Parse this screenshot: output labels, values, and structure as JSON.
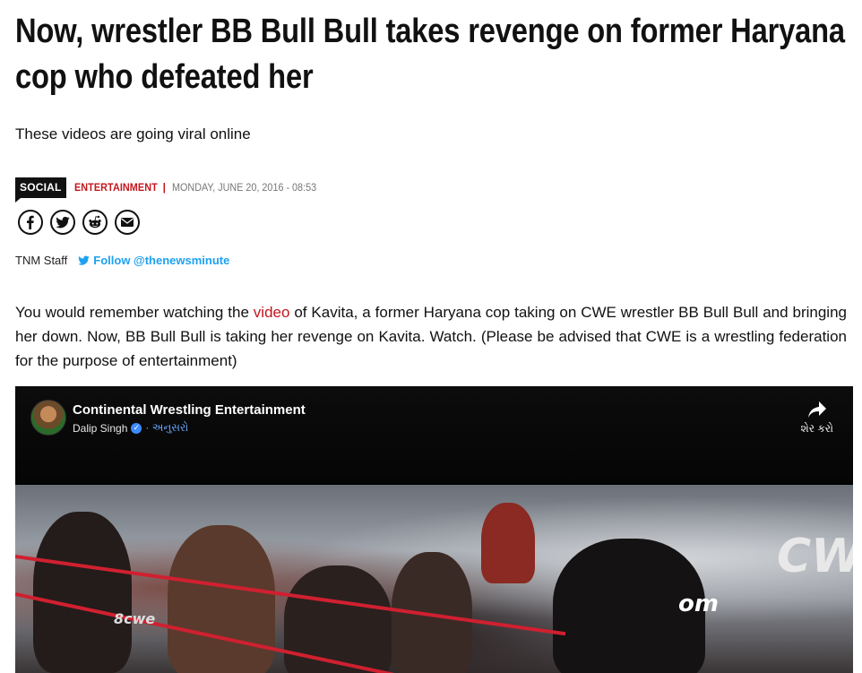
{
  "article": {
    "headline": "Now, wrestler BB Bull Bull takes revenge on former Haryana cop who defeated her",
    "subhead": "These videos are going viral online",
    "tag": "SOCIAL",
    "category": "ENTERTAINMENT",
    "separator": "|",
    "date": "MONDAY, JUNE 20, 2016 - 08:53",
    "author": "TNM Staff",
    "follow": "Follow @thenewsminute",
    "body_before": "You would remember watching the ",
    "body_link": "video",
    "body_after": " of Kavita, a former Haryana cop taking on CWE wrestler BB Bull Bull and bringing her down. Now, BB Bull Bull is taking her revenge on Kavita. Watch. (Please be advised that CWE is a wrestling federation for the purpose of entertainment)"
  },
  "share_icons": [
    "facebook-icon",
    "twitter-icon",
    "reddit-icon",
    "email-icon"
  ],
  "video": {
    "page_name": "Continental Wrestling Entertainment",
    "poster": "Dalip Singh",
    "follow_label": "· અનુસરો",
    "share_label": "શેર કરો",
    "banner_text": "CW",
    "banner_text2": "om",
    "banner_text3": "8cwe"
  },
  "colors": {
    "accent": "#c3161c",
    "twitter": "#1da1f2"
  }
}
